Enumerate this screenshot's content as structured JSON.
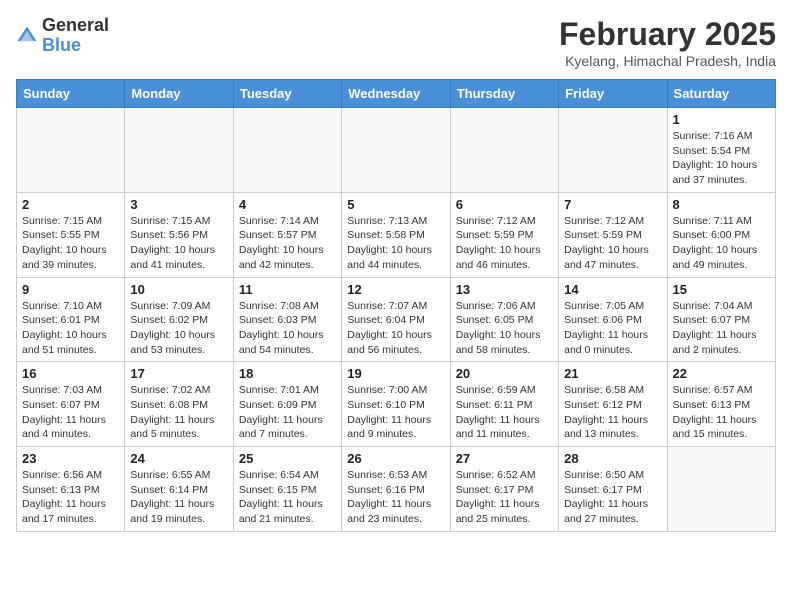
{
  "header": {
    "logo_general": "General",
    "logo_blue": "Blue",
    "month_year": "February 2025",
    "location": "Kyelang, Himachal Pradesh, India"
  },
  "weekdays": [
    "Sunday",
    "Monday",
    "Tuesday",
    "Wednesday",
    "Thursday",
    "Friday",
    "Saturday"
  ],
  "weeks": [
    [
      {
        "day": "",
        "info": ""
      },
      {
        "day": "",
        "info": ""
      },
      {
        "day": "",
        "info": ""
      },
      {
        "day": "",
        "info": ""
      },
      {
        "day": "",
        "info": ""
      },
      {
        "day": "",
        "info": ""
      },
      {
        "day": "1",
        "info": "Sunrise: 7:16 AM\nSunset: 5:54 PM\nDaylight: 10 hours and 37 minutes."
      }
    ],
    [
      {
        "day": "2",
        "info": "Sunrise: 7:15 AM\nSunset: 5:55 PM\nDaylight: 10 hours and 39 minutes."
      },
      {
        "day": "3",
        "info": "Sunrise: 7:15 AM\nSunset: 5:56 PM\nDaylight: 10 hours and 41 minutes."
      },
      {
        "day": "4",
        "info": "Sunrise: 7:14 AM\nSunset: 5:57 PM\nDaylight: 10 hours and 42 minutes."
      },
      {
        "day": "5",
        "info": "Sunrise: 7:13 AM\nSunset: 5:58 PM\nDaylight: 10 hours and 44 minutes."
      },
      {
        "day": "6",
        "info": "Sunrise: 7:12 AM\nSunset: 5:59 PM\nDaylight: 10 hours and 46 minutes."
      },
      {
        "day": "7",
        "info": "Sunrise: 7:12 AM\nSunset: 5:59 PM\nDaylight: 10 hours and 47 minutes."
      },
      {
        "day": "8",
        "info": "Sunrise: 7:11 AM\nSunset: 6:00 PM\nDaylight: 10 hours and 49 minutes."
      }
    ],
    [
      {
        "day": "9",
        "info": "Sunrise: 7:10 AM\nSunset: 6:01 PM\nDaylight: 10 hours and 51 minutes."
      },
      {
        "day": "10",
        "info": "Sunrise: 7:09 AM\nSunset: 6:02 PM\nDaylight: 10 hours and 53 minutes."
      },
      {
        "day": "11",
        "info": "Sunrise: 7:08 AM\nSunset: 6:03 PM\nDaylight: 10 hours and 54 minutes."
      },
      {
        "day": "12",
        "info": "Sunrise: 7:07 AM\nSunset: 6:04 PM\nDaylight: 10 hours and 56 minutes."
      },
      {
        "day": "13",
        "info": "Sunrise: 7:06 AM\nSunset: 6:05 PM\nDaylight: 10 hours and 58 minutes."
      },
      {
        "day": "14",
        "info": "Sunrise: 7:05 AM\nSunset: 6:06 PM\nDaylight: 11 hours and 0 minutes."
      },
      {
        "day": "15",
        "info": "Sunrise: 7:04 AM\nSunset: 6:07 PM\nDaylight: 11 hours and 2 minutes."
      }
    ],
    [
      {
        "day": "16",
        "info": "Sunrise: 7:03 AM\nSunset: 6:07 PM\nDaylight: 11 hours and 4 minutes."
      },
      {
        "day": "17",
        "info": "Sunrise: 7:02 AM\nSunset: 6:08 PM\nDaylight: 11 hours and 5 minutes."
      },
      {
        "day": "18",
        "info": "Sunrise: 7:01 AM\nSunset: 6:09 PM\nDaylight: 11 hours and 7 minutes."
      },
      {
        "day": "19",
        "info": "Sunrise: 7:00 AM\nSunset: 6:10 PM\nDaylight: 11 hours and 9 minutes."
      },
      {
        "day": "20",
        "info": "Sunrise: 6:59 AM\nSunset: 6:11 PM\nDaylight: 11 hours and 11 minutes."
      },
      {
        "day": "21",
        "info": "Sunrise: 6:58 AM\nSunset: 6:12 PM\nDaylight: 11 hours and 13 minutes."
      },
      {
        "day": "22",
        "info": "Sunrise: 6:57 AM\nSunset: 6:13 PM\nDaylight: 11 hours and 15 minutes."
      }
    ],
    [
      {
        "day": "23",
        "info": "Sunrise: 6:56 AM\nSunset: 6:13 PM\nDaylight: 11 hours and 17 minutes."
      },
      {
        "day": "24",
        "info": "Sunrise: 6:55 AM\nSunset: 6:14 PM\nDaylight: 11 hours and 19 minutes."
      },
      {
        "day": "25",
        "info": "Sunrise: 6:54 AM\nSunset: 6:15 PM\nDaylight: 11 hours and 21 minutes."
      },
      {
        "day": "26",
        "info": "Sunrise: 6:53 AM\nSunset: 6:16 PM\nDaylight: 11 hours and 23 minutes."
      },
      {
        "day": "27",
        "info": "Sunrise: 6:52 AM\nSunset: 6:17 PM\nDaylight: 11 hours and 25 minutes."
      },
      {
        "day": "28",
        "info": "Sunrise: 6:50 AM\nSunset: 6:17 PM\nDaylight: 11 hours and 27 minutes."
      },
      {
        "day": "",
        "info": ""
      }
    ]
  ]
}
